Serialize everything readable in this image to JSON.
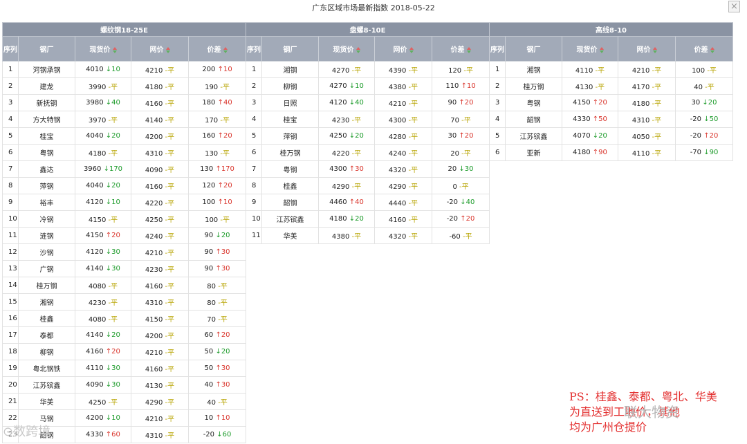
{
  "title": "广东区域市场最新指数 2018-05-22",
  "columns": [
    "序列",
    "钢厂",
    "现货价",
    "网价",
    "价差"
  ],
  "tables": [
    {
      "group": "螺纹钢18-25E",
      "rows": [
        [
          "1",
          "河钢承钢",
          "4010",
          "↓10",
          "down",
          "4210",
          "-平",
          "200",
          "↑10",
          "up"
        ],
        [
          "2",
          "建龙",
          "3990",
          "-平",
          "flat",
          "4180",
          "-平",
          "190",
          "-平",
          "flat"
        ],
        [
          "3",
          "新抚钢",
          "3980",
          "↓40",
          "down",
          "4160",
          "-平",
          "180",
          "↑40",
          "up"
        ],
        [
          "4",
          "方大特钢",
          "3970",
          "-平",
          "flat",
          "4140",
          "-平",
          "170",
          "-平",
          "flat"
        ],
        [
          "5",
          "桂宝",
          "4040",
          "↓20",
          "down",
          "4200",
          "-平",
          "160",
          "↑20",
          "up"
        ],
        [
          "6",
          "粤钢",
          "4180",
          "-平",
          "flat",
          "4310",
          "-平",
          "130",
          "-平",
          "flat"
        ],
        [
          "7",
          "鑫达",
          "3960",
          "↓170",
          "down",
          "4090",
          "-平",
          "130",
          "↑170",
          "up"
        ],
        [
          "8",
          "萍钢",
          "4040",
          "↓20",
          "down",
          "4160",
          "-平",
          "120",
          "↑20",
          "up"
        ],
        [
          "9",
          "裕丰",
          "4120",
          "↓10",
          "down",
          "4220",
          "-平",
          "100",
          "↑10",
          "up"
        ],
        [
          "10",
          "冷钢",
          "4150",
          "-平",
          "flat",
          "4250",
          "-平",
          "100",
          "-平",
          "flat"
        ],
        [
          "11",
          "涟钢",
          "4150",
          "↑20",
          "up",
          "4240",
          "-平",
          "90",
          "↓20",
          "down"
        ],
        [
          "12",
          "沙钢",
          "4120",
          "↓30",
          "down",
          "4210",
          "-平",
          "90",
          "↑30",
          "up"
        ],
        [
          "13",
          "广钢",
          "4140",
          "↓30",
          "down",
          "4230",
          "-平",
          "90",
          "↑30",
          "up"
        ],
        [
          "14",
          "桂万钢",
          "4080",
          "-平",
          "flat",
          "4160",
          "-平",
          "80",
          "-平",
          "flat"
        ],
        [
          "15",
          "湘钢",
          "4230",
          "-平",
          "flat",
          "4310",
          "-平",
          "80",
          "-平",
          "flat"
        ],
        [
          "16",
          "桂鑫",
          "4080",
          "-平",
          "flat",
          "4150",
          "-平",
          "70",
          "-平",
          "flat"
        ],
        [
          "17",
          "泰都",
          "4140",
          "↓20",
          "down",
          "4200",
          "-平",
          "60",
          "↑20",
          "up"
        ],
        [
          "18",
          "柳钢",
          "4160",
          "↑20",
          "up",
          "4210",
          "-平",
          "50",
          "↓20",
          "down"
        ],
        [
          "19",
          "粤北钢铁",
          "4110",
          "↓30",
          "down",
          "4160",
          "-平",
          "50",
          "↑30",
          "up"
        ],
        [
          "20",
          "江苏镔鑫",
          "4090",
          "↓30",
          "down",
          "4130",
          "-平",
          "40",
          "↑30",
          "up"
        ],
        [
          "21",
          "华美",
          "4250",
          "-平",
          "flat",
          "4290",
          "-平",
          "40",
          "-平",
          "flat"
        ],
        [
          "22",
          "马钢",
          "4200",
          "↓10",
          "down",
          "4210",
          "-平",
          "10",
          "↑10",
          "up"
        ],
        [
          "23",
          "韶钢",
          "4330",
          "↑60",
          "up",
          "4310",
          "-平",
          "-20",
          "↓60",
          "down"
        ]
      ]
    },
    {
      "group": "盘螺8-10E",
      "rows": [
        [
          "1",
          "湘钢",
          "4270",
          "-平",
          "flat",
          "4390",
          "-平",
          "120",
          "-平",
          "flat"
        ],
        [
          "2",
          "柳钢",
          "4270",
          "↓10",
          "down",
          "4380",
          "-平",
          "110",
          "↑10",
          "up"
        ],
        [
          "3",
          "日照",
          "4120",
          "↓40",
          "down",
          "4210",
          "-平",
          "90",
          "↑20",
          "up"
        ],
        [
          "4",
          "桂宝",
          "4230",
          "-平",
          "flat",
          "4300",
          "-平",
          "70",
          "-平",
          "flat"
        ],
        [
          "5",
          "萍钢",
          "4250",
          "↓20",
          "down",
          "4280",
          "-平",
          "30",
          "↑20",
          "up"
        ],
        [
          "6",
          "桂万钢",
          "4220",
          "-平",
          "flat",
          "4240",
          "-平",
          "20",
          "-平",
          "flat"
        ],
        [
          "7",
          "粤钢",
          "4300",
          "↑30",
          "up",
          "4320",
          "-平",
          "20",
          "↓30",
          "down"
        ],
        [
          "8",
          "桂鑫",
          "4290",
          "-平",
          "flat",
          "4290",
          "-平",
          "0",
          "-平",
          "flat"
        ],
        [
          "9",
          "韶钢",
          "4460",
          "↑40",
          "up",
          "4440",
          "-平",
          "-20",
          "↓40",
          "down"
        ],
        [
          "10",
          "江苏镔鑫",
          "4180",
          "↓20",
          "down",
          "4160",
          "-平",
          "-20",
          "↑20",
          "up"
        ],
        [
          "11",
          "华美",
          "4380",
          "-平",
          "flat",
          "4320",
          "-平",
          "-60",
          "-平",
          "flat"
        ]
      ]
    },
    {
      "group": "高线8-10",
      "rows": [
        [
          "1",
          "湘钢",
          "4110",
          "-平",
          "flat",
          "4210",
          "-平",
          "100",
          "-平",
          "flat"
        ],
        [
          "2",
          "桂万钢",
          "4130",
          "-平",
          "flat",
          "4170",
          "-平",
          "40",
          "-平",
          "flat"
        ],
        [
          "3",
          "粤钢",
          "4150",
          "↑20",
          "up",
          "4180",
          "-平",
          "30",
          "↓20",
          "down"
        ],
        [
          "4",
          "韶钢",
          "4330",
          "↑50",
          "up",
          "4310",
          "-平",
          "-20",
          "↓50",
          "down"
        ],
        [
          "5",
          "江苏镔鑫",
          "4070",
          "↓20",
          "down",
          "4050",
          "-平",
          "-20",
          "↑20",
          "up"
        ],
        [
          "6",
          "亚新",
          "4180",
          "↑90",
          "up",
          "4110",
          "-平",
          "-70",
          "↓90",
          "down"
        ]
      ]
    }
  ],
  "note": {
    "line1": "PS：桂鑫、泰都、粤北、华美",
    "line2": "为直送到工地价，其他",
    "line3": "均为广州仓提价"
  },
  "watermarks": {
    "left": "⊙数跨境",
    "right": "联大物资"
  },
  "colors": {
    "up": "#d9342b",
    "down": "#1a9a28",
    "flat": "#b8a400",
    "note": "#e33030",
    "group_header": "#8a93a3",
    "column_header": "#a2aab8"
  }
}
